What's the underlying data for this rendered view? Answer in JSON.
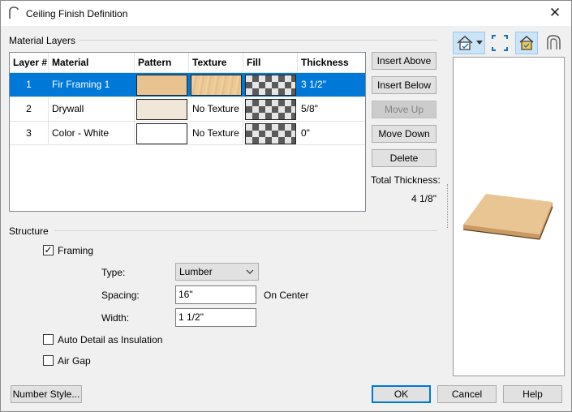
{
  "window": {
    "title": "Ceiling Finish Definition",
    "close_glyph": "✕"
  },
  "material_layers": {
    "label": "Material Layers",
    "headers": [
      "Layer #",
      "Material",
      "Pattern",
      "Texture",
      "Fill",
      "Thickness"
    ],
    "rows": [
      {
        "num": "1",
        "material": "Fir Framing 1",
        "pattern_color": "#e8c390",
        "texture": "",
        "texture_kind": "wood",
        "thickness": "3 1/2\"",
        "selected": true
      },
      {
        "num": "2",
        "material": "Drywall",
        "pattern_color": "#f0e7d9",
        "texture": "No Texture",
        "texture_kind": "none",
        "thickness": "5/8\"",
        "selected": false
      },
      {
        "num": "3",
        "material": "Color - White",
        "pattern_color": "#ffffff",
        "texture": "No Texture",
        "texture_kind": "none",
        "thickness": "0\"",
        "selected": false
      }
    ]
  },
  "side_buttons": {
    "insert_above": "Insert Above",
    "insert_below": "Insert Below",
    "move_up": "Move Up",
    "move_down": "Move Down",
    "delete": "Delete"
  },
  "total": {
    "label": "Total Thickness:",
    "value": "4 1/8\""
  },
  "structure": {
    "label": "Structure",
    "framing_label": "Framing",
    "framing_checked": true,
    "type_label": "Type:",
    "type_value": "Lumber",
    "spacing_label": "Spacing:",
    "spacing_value": "16\"",
    "on_center": "On Center",
    "width_label": "Width:",
    "width_value": "1 1/2\"",
    "auto_detail_label": "Auto Detail as Insulation",
    "auto_detail_checked": false,
    "air_gap_label": "Air Gap",
    "air_gap_checked": false
  },
  "footer": {
    "number_style": "Number Style...",
    "ok": "OK",
    "cancel": "Cancel",
    "help": "Help"
  },
  "preview": {
    "toolbar_icons": [
      "view-camera-icon",
      "fill-window-icon",
      "color-toggle-icon",
      "cross-section-icon"
    ],
    "slab_top": "#e9c594",
    "slab_side": "#c99a62"
  },
  "colors": {
    "accent": "#0078d7",
    "selection": "#0078d7"
  }
}
